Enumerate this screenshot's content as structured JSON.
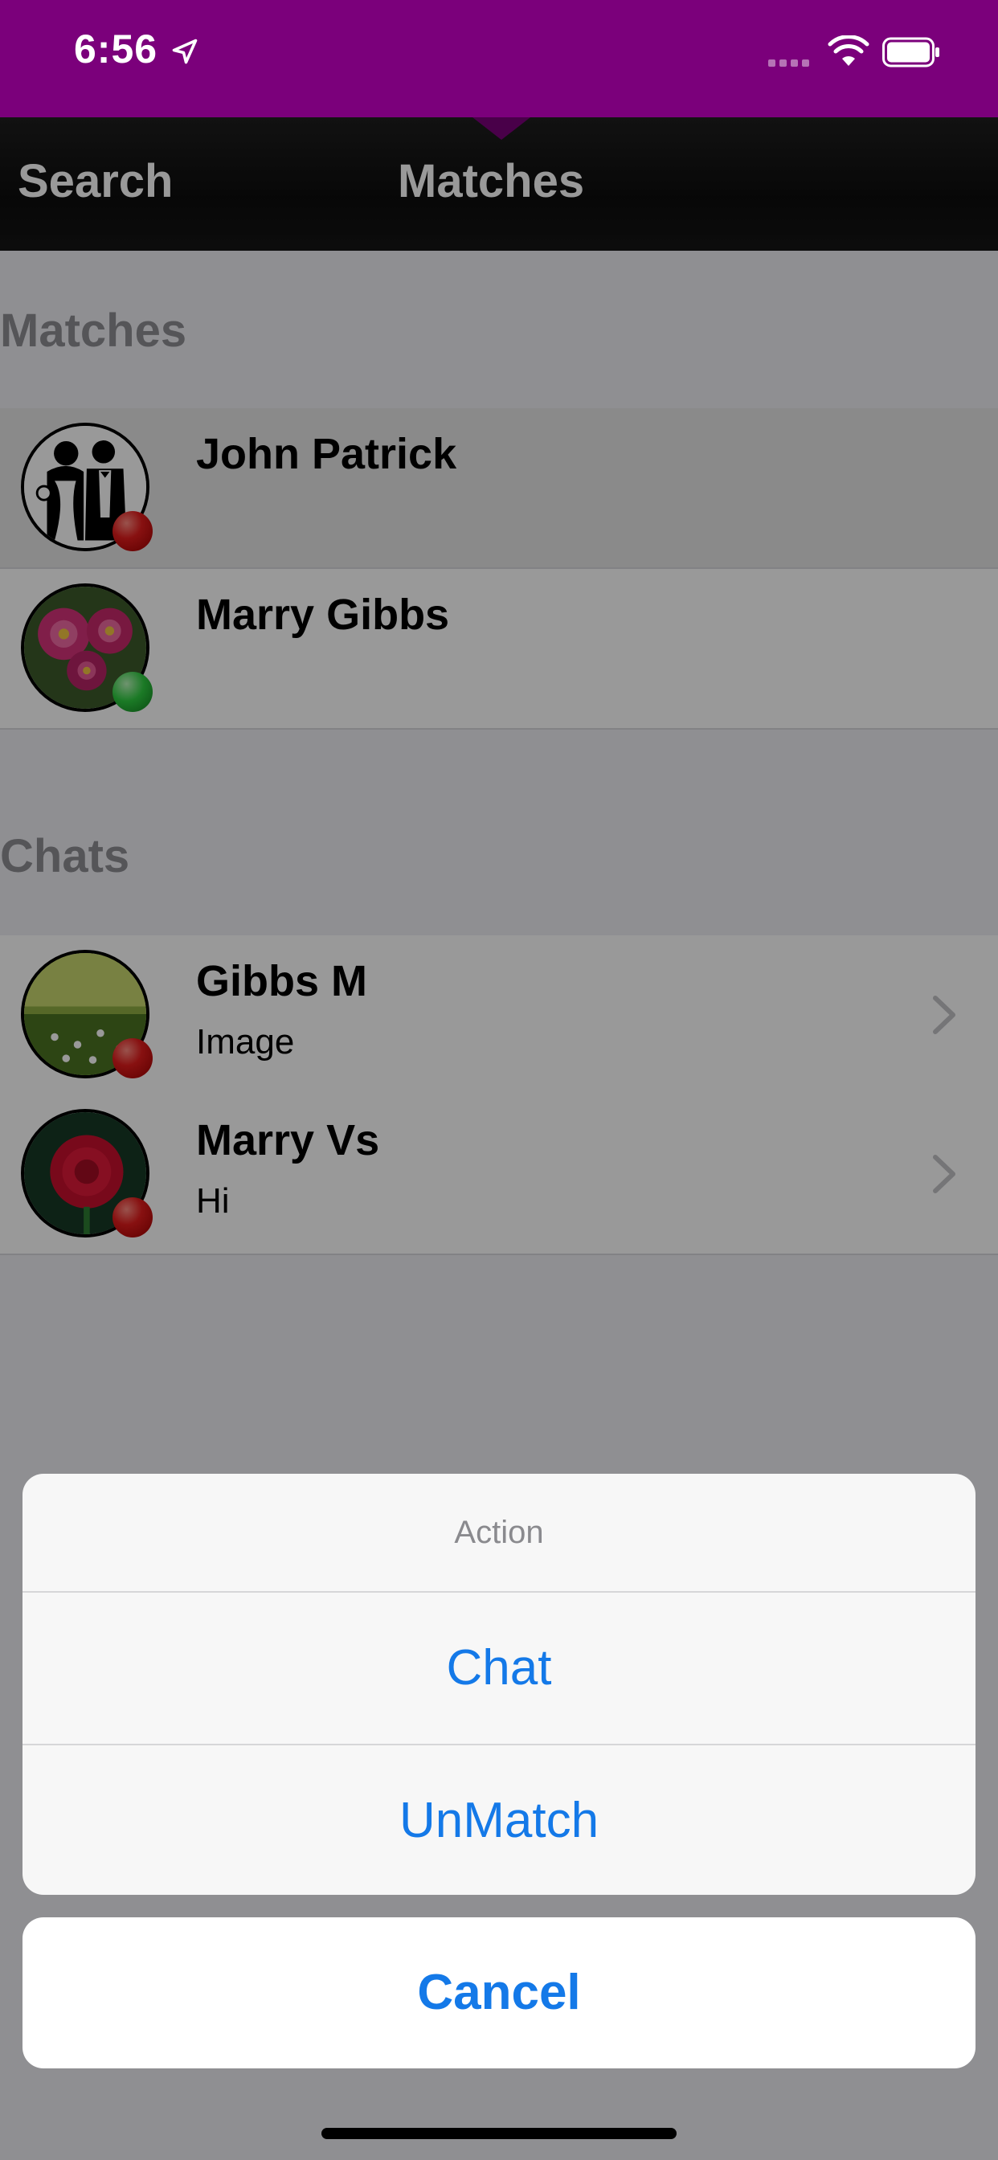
{
  "status_bar": {
    "time": "6:56",
    "icons": [
      "location-arrow-icon",
      "cellular-signal-icon",
      "wifi-icon",
      "battery-icon"
    ]
  },
  "tabs": [
    {
      "label": "Search"
    },
    {
      "label": "Matches",
      "selected": true
    }
  ],
  "matches_section": {
    "title": "Matches",
    "items": [
      {
        "name": "John Patrick",
        "status": "offline",
        "status_color": "#e21c1c"
      },
      {
        "name": "Marry Gibbs",
        "status": "online",
        "status_color": "#2ecc40"
      }
    ]
  },
  "chats_section": {
    "title": "Chats",
    "items": [
      {
        "name": "Gibbs M",
        "last_message": "Image",
        "status_color": "#e21c1c"
      },
      {
        "name": "Marry Vs",
        "last_message": "Hi",
        "status_color": "#e21c1c"
      }
    ]
  },
  "action_sheet": {
    "title": "Action",
    "buttons": [
      "Chat",
      "UnMatch"
    ],
    "cancel": "Cancel"
  },
  "colors": {
    "status_bar": "#7b007b",
    "action_blue": "#1479e8"
  }
}
